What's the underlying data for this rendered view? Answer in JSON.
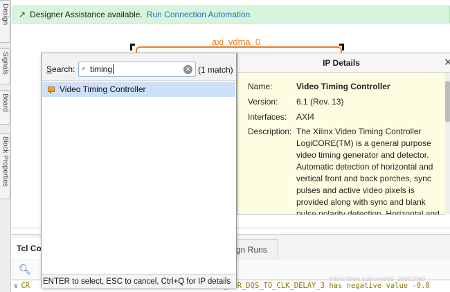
{
  "left_tabs": [
    "Design",
    "Signals",
    "Board",
    "Block Properties"
  ],
  "banner": {
    "message": "Designer Assistance available.",
    "link": "Run Connection Automation",
    "icon": "pin-icon"
  },
  "diagram": {
    "block_name": "axi_vdma_0"
  },
  "search_popup": {
    "label_prefix": "S",
    "label_rest": "earch:",
    "query": "timing",
    "match_count": "(1 match)",
    "results": [
      {
        "label": "Video Timing Controller",
        "icon": "ip-core-icon"
      }
    ],
    "footer": "ENTER to select, ESC to cancel, Ctrl+Q for IP details"
  },
  "ip_details": {
    "title": "IP Details",
    "fields": [
      {
        "key": "Name:",
        "value": "Video Timing Controller"
      },
      {
        "key": "Version:",
        "value": "6.1 (Rev. 13)"
      },
      {
        "key": "Interfaces:",
        "value": "AXI4"
      },
      {
        "key": "Description:",
        "value": "The Xilinx Video Timing Controller LogiCORE(TM) is a general purpose video timing generator and detector. Automatic detection of horizontal and vertical front and back porches, sync pulses and active video pixels is provided along with sync and blank pulse polarity detection. Horizontal and"
      }
    ]
  },
  "console": {
    "tab_label": "Tcl Co",
    "tab2_label": "gn Runs",
    "log_prefix": "CR",
    "log_text": "AM_DDR_DQS_TO_CLK_DELAY_3 has negative value -0.0",
    "watermark": "https://blog.csdn.net/qq_26652069"
  }
}
